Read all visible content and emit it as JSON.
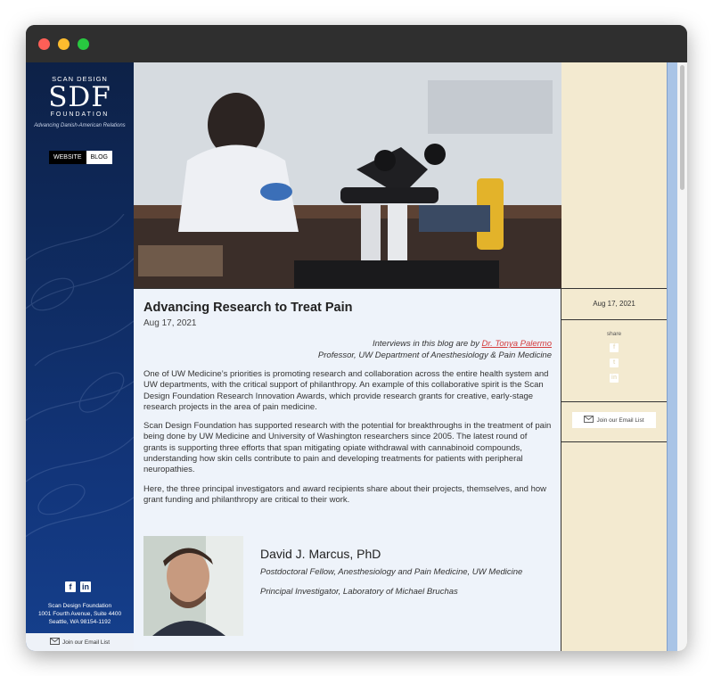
{
  "sidebar": {
    "brand_top": "SCAN DESIGN",
    "brand_main": "SDF",
    "brand_bottom": "FOUNDATION",
    "tagline": "Advancing Danish-American Relations",
    "tabs": [
      "WEBSITE",
      "BLOG"
    ],
    "social_icons": [
      "facebook-icon",
      "linkedin-icon"
    ],
    "address_lines": [
      "Scan Design Foundation",
      "1001 Fourth Avenue, Suite 4400",
      "Seattle, WA 98154-1192"
    ],
    "email_label": "Join our Email List"
  },
  "article": {
    "title": "Advancing Research to Treat Pain",
    "date": "Aug 17, 2021",
    "credit_prefix": "Interviews in this blog are by",
    "credit_name": "Dr. Tonya Palermo",
    "credit_role": "Professor, UW Department of Anesthesiology & Pain Medicine",
    "paragraphs": [
      "One of UW Medicine’s priorities is promoting research and collaboration across the entire health system and UW departments, with the critical support of philanthropy. An example of this collaborative spirit is the Scan Design Foundation Research Innovation Awards, which provide research grants for creative, early-stage research projects in the area of pain medicine.",
      "Scan Design Foundation has supported research with the potential for breakthroughs in the treatment of pain being done by UW Medicine and University of Washington researchers since 2005. The latest round of grants is supporting three efforts that span mitigating opiate withdrawal with cannabinoid compounds, understanding how skin cells contribute to pain and developing treatments for patients with peripheral neuropathies.",
      "Here, the three principal investigators and award recipients share about their projects, themselves, and how grant funding and philanthropy are critical to their work."
    ],
    "person": {
      "name": "David J. Marcus, PhD",
      "role": "Postdoctoral Fellow, Anesthesiology and Pain Medicine, UW Medicine",
      "role2": "Principal Investigator, Laboratory of Michael Bruchas"
    }
  },
  "right": {
    "date": "Aug 17, 2021",
    "share_label": "share",
    "share_icons": [
      "facebook-icon",
      "twitter-icon",
      "linkedin-icon"
    ],
    "email_label": "Join our Email List"
  }
}
